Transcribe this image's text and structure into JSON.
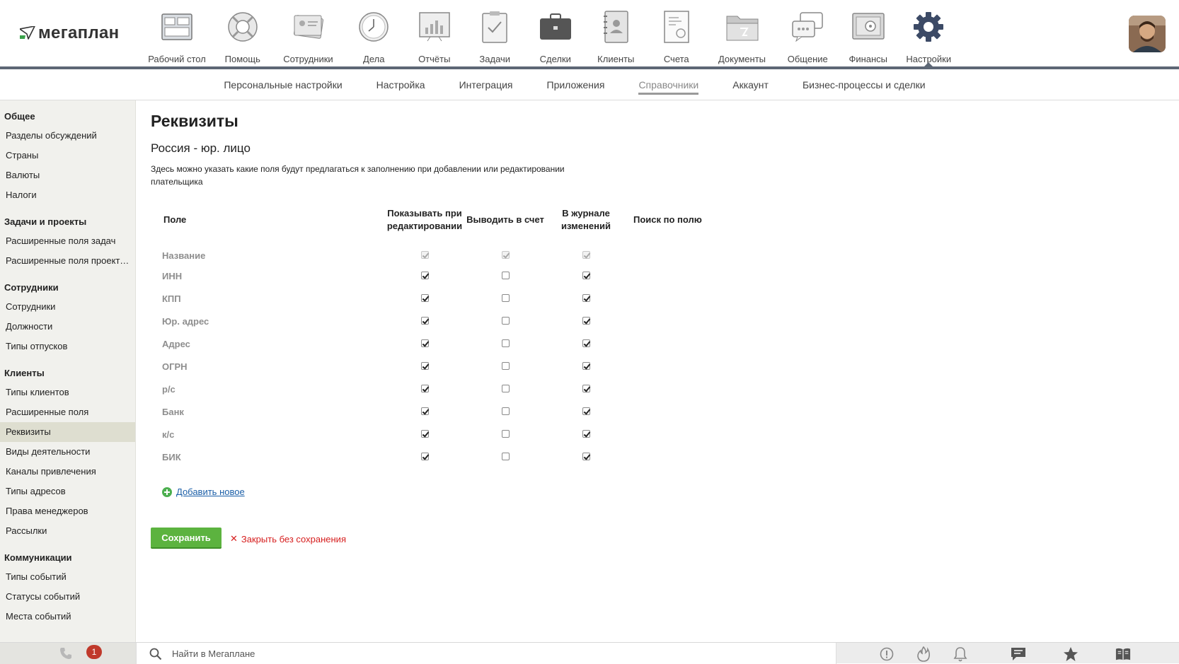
{
  "app": {
    "logo_text": "мегаплан"
  },
  "nav": [
    {
      "label": "Рабочий стол",
      "icon": "desktop-icon"
    },
    {
      "label": "Помощь",
      "icon": "lifebuoy-icon"
    },
    {
      "label": "Сотрудники",
      "icon": "employees-icon"
    },
    {
      "label": "Дела",
      "icon": "clock-icon"
    },
    {
      "label": "Отчёты",
      "icon": "reports-icon"
    },
    {
      "label": "Задачи",
      "icon": "tasks-icon"
    },
    {
      "label": "Сделки",
      "icon": "briefcase-icon"
    },
    {
      "label": "Клиенты",
      "icon": "clients-icon"
    },
    {
      "label": "Счета",
      "icon": "invoice-icon"
    },
    {
      "label": "Документы",
      "icon": "folder-icon"
    },
    {
      "label": "Общение",
      "icon": "chat-icon"
    },
    {
      "label": "Финансы",
      "icon": "safe-icon"
    },
    {
      "label": "Настройки",
      "icon": "gear-icon"
    }
  ],
  "subnav": [
    {
      "label": "Персональные настройки"
    },
    {
      "label": "Настройка"
    },
    {
      "label": "Интеграция"
    },
    {
      "label": "Приложения"
    },
    {
      "label": "Справочники"
    },
    {
      "label": "Аккаунт"
    },
    {
      "label": "Бизнес-процессы и сделки"
    }
  ],
  "sidebar": {
    "groups": [
      {
        "title": "Общее",
        "items": [
          "Разделы обсуждений",
          "Страны",
          "Валюты",
          "Налоги"
        ]
      },
      {
        "title": "Задачи и проекты",
        "items": [
          "Расширенные поля задач",
          "Расширенные поля проектов"
        ]
      },
      {
        "title": "Сотрудники",
        "items": [
          "Сотрудники",
          "Должности",
          "Типы отпусков"
        ]
      },
      {
        "title": "Клиенты",
        "items": [
          "Типы клиентов",
          "Расширенные поля",
          "Реквизиты",
          "Виды деятельности",
          "Каналы привлечения",
          "Типы адресов",
          "Права менеджеров",
          "Рассылки"
        ]
      },
      {
        "title": "Коммуникации",
        "items": [
          "Типы событий",
          "Статусы событий",
          "Места событий"
        ]
      }
    ]
  },
  "page": {
    "title": "Реквизиты",
    "subtitle": "Россия - юр. лицо",
    "description": "Здесь можно указать какие поля будут предлагаться к заполнению при добавлении или редактировании плательщика"
  },
  "table": {
    "headers": {
      "field": "Поле",
      "show_on_edit": "Показывать при редактировании",
      "print_on_invoice": "Выводить в счет",
      "in_changelog": "В журнале изменений",
      "search_by_field": "Поиск по полю"
    },
    "rows": [
      {
        "name": "Название",
        "show_on_edit": true,
        "print_on_invoice": true,
        "in_changelog": true,
        "locked": true
      },
      {
        "name": "ИНН",
        "show_on_edit": true,
        "print_on_invoice": false,
        "in_changelog": true,
        "locked": false
      },
      {
        "name": "КПП",
        "show_on_edit": true,
        "print_on_invoice": false,
        "in_changelog": true,
        "locked": false
      },
      {
        "name": "Юр. адрес",
        "show_on_edit": true,
        "print_on_invoice": false,
        "in_changelog": true,
        "locked": false
      },
      {
        "name": "Адрес",
        "show_on_edit": true,
        "print_on_invoice": false,
        "in_changelog": true,
        "locked": false
      },
      {
        "name": "ОГРН",
        "show_on_edit": true,
        "print_on_invoice": false,
        "in_changelog": true,
        "locked": false
      },
      {
        "name": "р/с",
        "show_on_edit": true,
        "print_on_invoice": false,
        "in_changelog": true,
        "locked": false
      },
      {
        "name": "Банк",
        "show_on_edit": true,
        "print_on_invoice": false,
        "in_changelog": true,
        "locked": false
      },
      {
        "name": "к/с",
        "show_on_edit": true,
        "print_on_invoice": false,
        "in_changelog": true,
        "locked": false
      },
      {
        "name": "БИК",
        "show_on_edit": true,
        "print_on_invoice": false,
        "in_changelog": true,
        "locked": false
      }
    ]
  },
  "actions": {
    "add_new": "Добавить новое",
    "save": "Сохранить",
    "close_without_saving": "Закрыть без сохранения"
  },
  "bottombar": {
    "notifications_count": "1",
    "search_placeholder": "Найти в Мегаплане"
  },
  "colors": {
    "accent_green": "#5cb33f",
    "danger_red": "#d61e1e",
    "link_blue": "#1b5fa8",
    "nav_dark": "#5d6775"
  }
}
